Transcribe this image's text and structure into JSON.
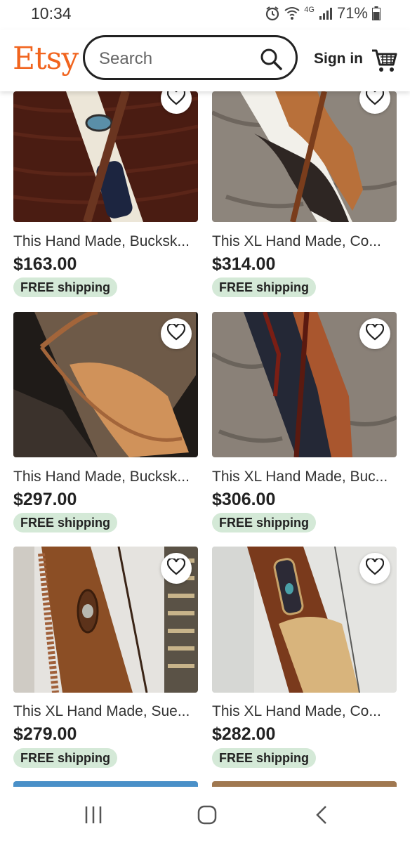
{
  "status_bar": {
    "time": "10:34",
    "network": "4G",
    "battery": "71%"
  },
  "header": {
    "logo": "Etsy",
    "search_placeholder": "Search",
    "sign_in": "Sign in"
  },
  "products": [
    {
      "title": "This Hand Made, Bucksk...",
      "price": "$163.00",
      "shipping": "FREE shipping"
    },
    {
      "title": "This XL Hand Made, Co...",
      "price": "$314.00",
      "shipping": "FREE shipping"
    },
    {
      "title": "This Hand Made, Bucksk...",
      "price": "$297.00",
      "shipping": "FREE shipping"
    },
    {
      "title": "This XL Hand Made, Buc...",
      "price": "$306.00",
      "shipping": "FREE shipping"
    },
    {
      "title": "This XL Hand Made, Sue...",
      "price": "$279.00",
      "shipping": "FREE shipping"
    },
    {
      "title": "This XL Hand Made, Co...",
      "price": "$282.00",
      "shipping": "FREE shipping"
    }
  ],
  "colors": {
    "brand": "#f1641e",
    "badge_bg": "#d4e9d7"
  }
}
